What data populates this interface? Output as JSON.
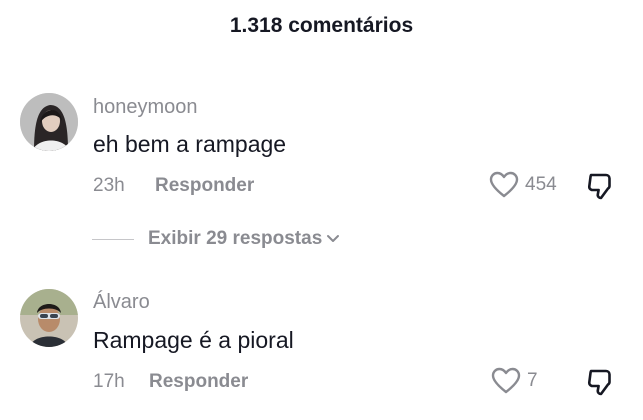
{
  "header": {
    "title": "1.318 comentários"
  },
  "comments": [
    {
      "username": "honeymoon",
      "text": "eh bem a rampage",
      "time": "23h",
      "reply_label": "Responder",
      "likes": "454",
      "view_replies_label": "Exibir 29 respostas"
    },
    {
      "username": "Álvaro",
      "text": "Rampage é a pioral",
      "time": "17h",
      "reply_label": "Responder",
      "likes": "7"
    }
  ],
  "icons": {
    "like": "heart-icon",
    "dislike": "thumbs-down-icon",
    "expand": "chevron-down-icon"
  },
  "colors": {
    "primary_text": "#161823",
    "secondary_text": "#8a8b91"
  }
}
